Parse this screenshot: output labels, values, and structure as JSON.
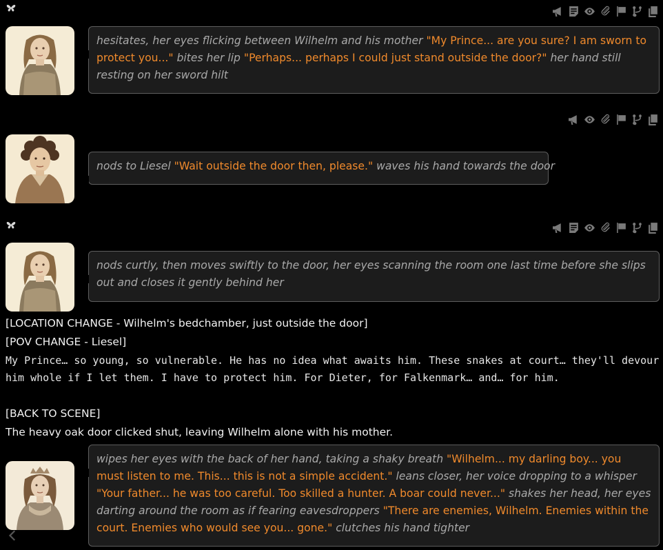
{
  "messages": [
    {
      "avatar": "armored-woman-portrait",
      "segments": [
        {
          "type": "action",
          "text": "hesitates, her eyes flicking between Wilhelm and his mother "
        },
        {
          "type": "speech",
          "text": "\"My Prince... are you sure? I am sworn to protect you...\""
        },
        {
          "type": "action",
          "text": " bites her lip "
        },
        {
          "type": "speech",
          "text": "\"Perhaps... perhaps I could just stand outside the door?\""
        },
        {
          "type": "action",
          "text": " her hand still resting on her sword hilt"
        }
      ]
    },
    {
      "avatar": "curly-haired-youth-portrait",
      "segments": [
        {
          "type": "action",
          "text": "nods to Liesel "
        },
        {
          "type": "speech",
          "text": "\"Wait outside the door then, please.\""
        },
        {
          "type": "action",
          "text": " waves his hand towards the door"
        }
      ]
    },
    {
      "avatar": "armored-woman-portrait",
      "segments": [
        {
          "type": "action",
          "text": "nods curtly, then moves swiftly to the door, her eyes scanning the room one last time before she slips out and closes it gently behind her"
        }
      ]
    },
    {
      "avatar": "crowned-lady-portrait",
      "segments": [
        {
          "type": "action",
          "text": "wipes her eyes with the back of her hand, taking a shaky breath "
        },
        {
          "type": "speech",
          "text": "\"Wilhelm... my darling boy... you must listen to me. This... this is not a simple accident.\""
        },
        {
          "type": "action",
          "text": " leans closer, her voice dropping to a whisper "
        },
        {
          "type": "speech",
          "text": "\"Your father... he was too careful. Too skilled a hunter. A boar could never...\""
        },
        {
          "type": "action",
          "text": " shakes her head, her eyes darting around the room as if fearing eavesdroppers "
        },
        {
          "type": "speech",
          "text": "\"There are enemies, Wilhelm. Enemies within the court. Enemies who would see you... gone.\""
        },
        {
          "type": "action",
          "text": " clutches his hand tighter"
        }
      ]
    }
  ],
  "narration": {
    "location_change": "[LOCATION CHANGE - Wilhelm's bedchamber, just outside the door]",
    "pov_change": "[POV CHANGE - Liesel]",
    "inner_thought": " My Prince… so young, so vulnerable. He has no idea what awaits him. These snakes at court… they'll devour him whole if I let them. I have to protect him. For Dieter, for Falkenmark… and… for him.",
    "back_to_scene": "[BACK TO SCENE]",
    "door_line": "The heavy oak door clicked shut, leaving Wilhelm alone with his mother."
  },
  "colors": {
    "speech": "#f08a2c",
    "action": "#a9a9a9",
    "bubble_bg": "#1c1c1c",
    "bubble_border": "#5e5e5e"
  },
  "toolbar_icons": [
    "megaphone-icon",
    "note-icon",
    "eye-icon",
    "paperclip-icon",
    "flag-icon",
    "branch-icon",
    "copy-icon"
  ]
}
